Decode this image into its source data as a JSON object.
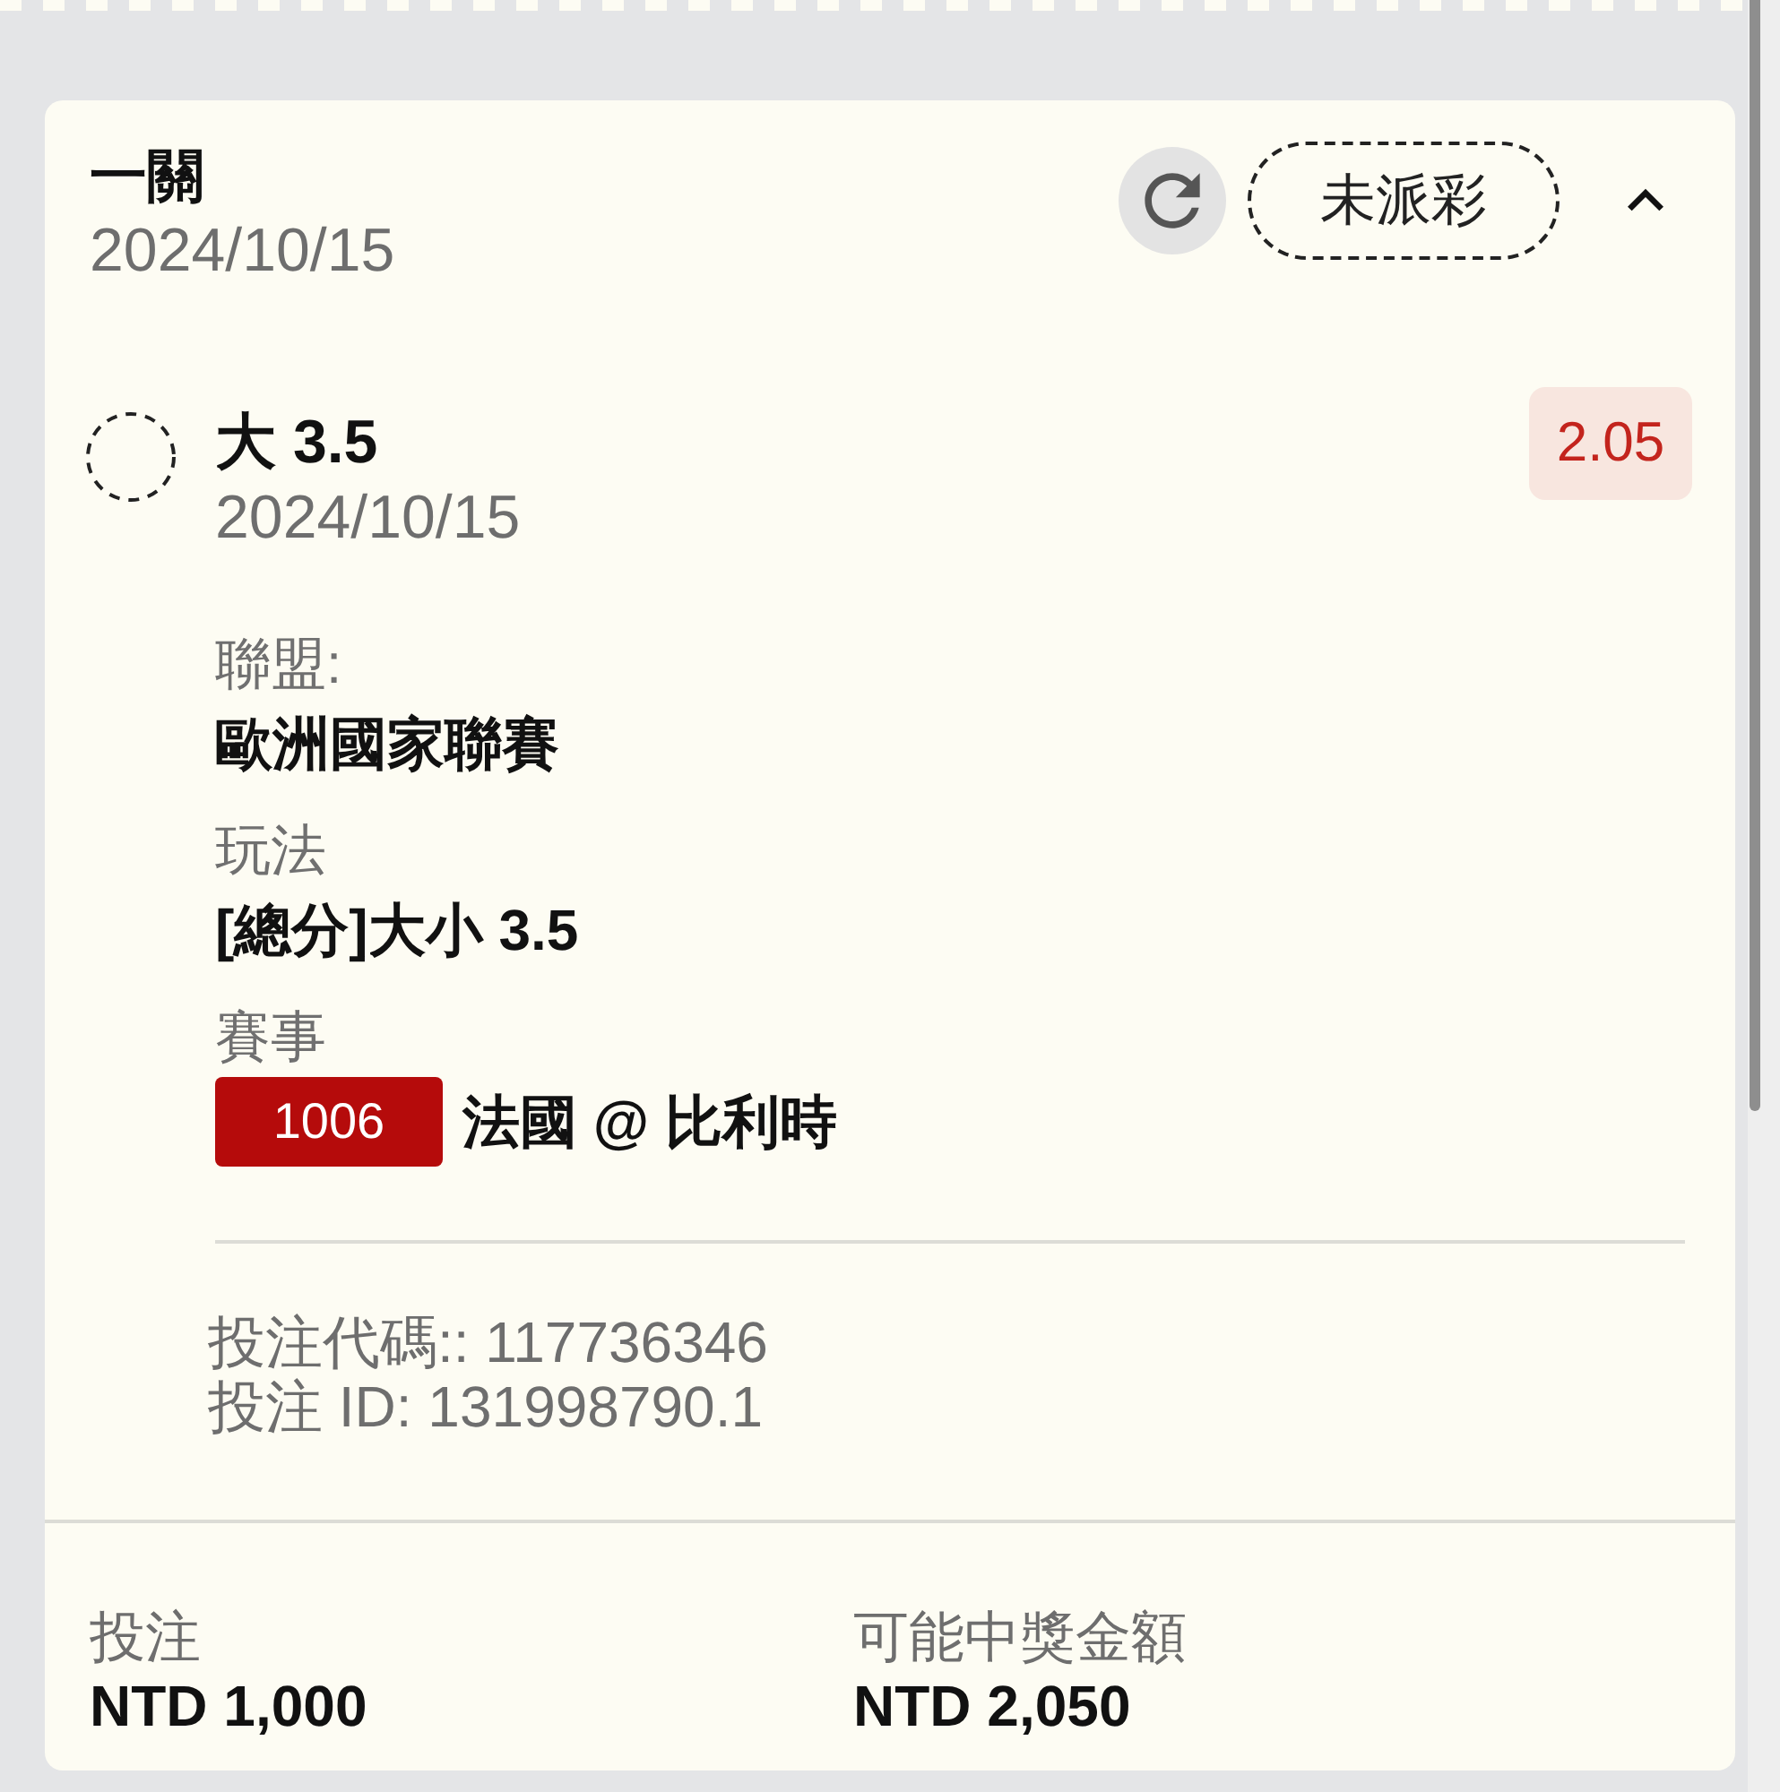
{
  "bet": {
    "title": "一關",
    "date": "2024/10/15",
    "status": "未派彩",
    "expanded": true
  },
  "selection": {
    "pick": "大 3.5",
    "date": "2024/10/15",
    "odds": "2.05"
  },
  "details": [
    {
      "kind": "text",
      "label": "聯盟:",
      "value": "歐洲國家聯賽"
    },
    {
      "kind": "text",
      "label": "玩法",
      "value": "[總分]大小 3.5"
    },
    {
      "kind": "match",
      "label": "賽事",
      "code": "1006",
      "value": "法國 @ 比利時"
    }
  ],
  "codes": [
    "投注代碼:: 117736346",
    "投注 ID: 131998790.1"
  ],
  "summary": [
    {
      "label": "投注",
      "value": "NTD 1,000"
    },
    {
      "label": "可能中獎金額",
      "value": "NTD 2,050"
    }
  ]
}
